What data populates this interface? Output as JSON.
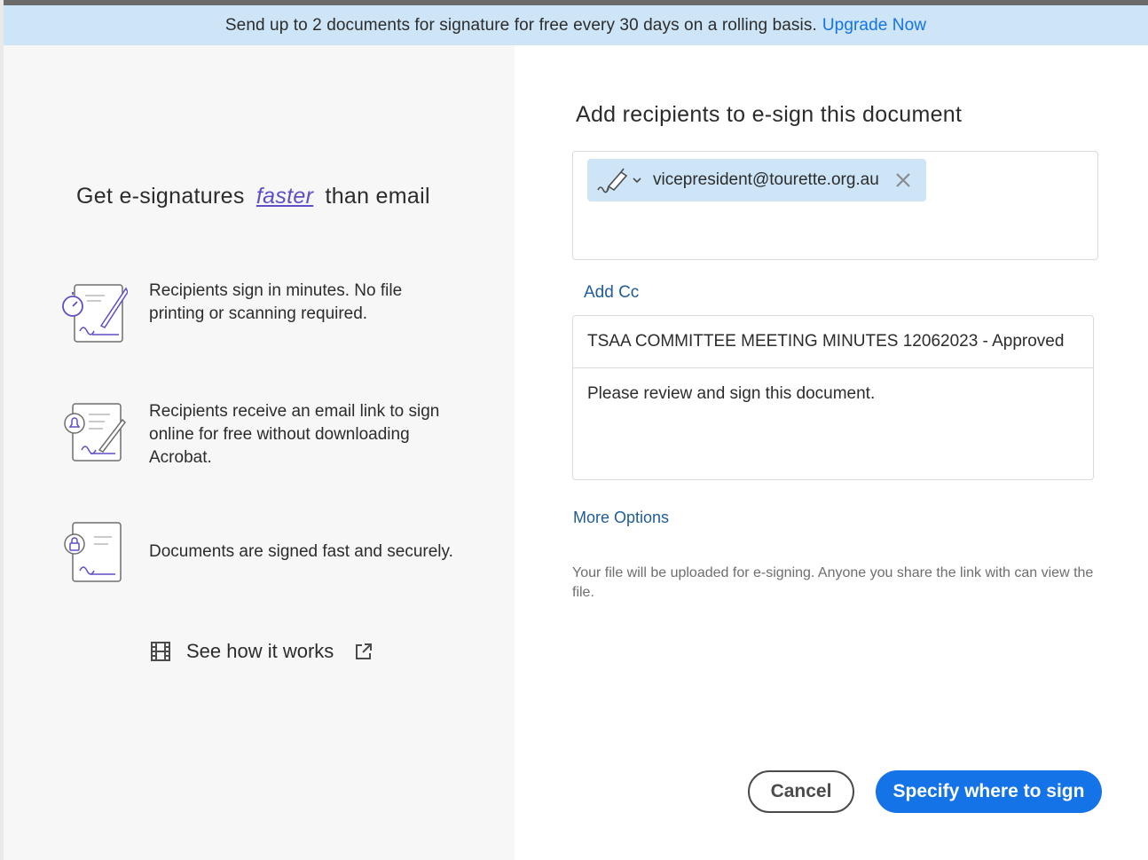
{
  "banner": {
    "text": "Send up to 2 documents for signature for free every 30 days on a rolling basis.",
    "link": "Upgrade Now"
  },
  "left": {
    "title_prefix": "Get e-signatures",
    "title_accent": "faster",
    "title_suffix": "than email",
    "features": [
      {
        "icon": "stopwatch-pen-document-icon",
        "text": "Recipients sign in minutes. No file printing or scanning required."
      },
      {
        "icon": "bell-document-icon",
        "text": "Recipients receive an email link to sign online for free without downloading Acrobat."
      },
      {
        "icon": "lock-document-icon",
        "text": "Documents are signed fast and securely."
      }
    ],
    "see_how": "See how it works"
  },
  "right": {
    "title": "Add recipients to e-sign this document",
    "recipient": {
      "email": "vicepresident@tourette.org.au",
      "role_icon": "signer-pen-icon"
    },
    "add_cc": "Add Cc",
    "subject": "TSAA COMMITTEE MEETING MINUTES 12062023 - Approved",
    "message": "Please review and sign this document.",
    "more_options": "More Options",
    "disclaimer": "Your file will be uploaded for e-signing. Anyone you share the link with can view the file.",
    "cancel": "Cancel",
    "primary": "Specify where to sign"
  },
  "colors": {
    "accent": "#1473e6",
    "banner_bg": "#cde5f7",
    "link": "#1f5c99",
    "purple_accent": "#5e4fc7"
  }
}
